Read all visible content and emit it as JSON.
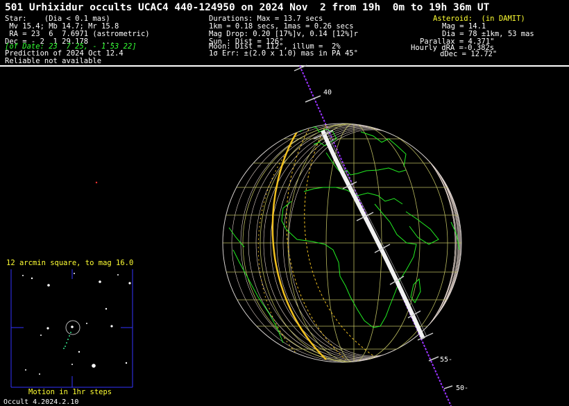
{
  "title": "501 Urhixidur occults UCAC4 440-124950 on 2024 Nov  2 from 19h  0m to 19h 36m UT",
  "star": {
    "lines": [
      "Star:    (Dia < 0.1 mas)",
      " Mv 15.4; Mb 14.7; Mr 15.8",
      " RA = 23  6  7.6971 (astrometric)",
      "Dec = - 2  1 29.178   ...",
      "[of Date: 23  7 25, - 1 53 22]",
      "Prediction of 2024 Oct 12.4",
      "Reliable not available"
    ]
  },
  "event": {
    "lines": [
      "Durations: Max = 13.7 secs",
      "1km = 0.18 secs, 1mas = 0.26 secs",
      "Mag Drop: 0.20 [17%]v, 0.14 [12%]r",
      "Sun : Dist = 126°",
      "Moon: Dist = 112°, illum =  2%",
      "1σ Err: ±(2.0 x 1.0) mas in PA 45°"
    ]
  },
  "asteroid": {
    "header": "Asteroid:  (in DAMIT)",
    "lines": [
      "Mag = 14.1",
      "Dia = 78 ±1km, 53 mas",
      "Parallax = 4.371\"",
      "Hourly dRA =-0.382s",
      "dDec = 12.72\""
    ]
  },
  "globe": {
    "labels": [
      "40",
      "55-",
      "50-"
    ]
  },
  "finder": {
    "title": "12 arcmin square, to mag 16.0",
    "caption": "Motion in 1hr steps"
  },
  "version": "Occult 4.2024.2.10",
  "colors": {
    "background": "#000000",
    "text": "#ffffff",
    "highlight": "#ffff33",
    "date_text": "#33ff33",
    "coastline": "#22ee22",
    "grid": "#bcbc60",
    "path": "#ffffff",
    "terminator": "#f0c020",
    "track": "#9933ff",
    "frame": "#3333ff"
  }
}
